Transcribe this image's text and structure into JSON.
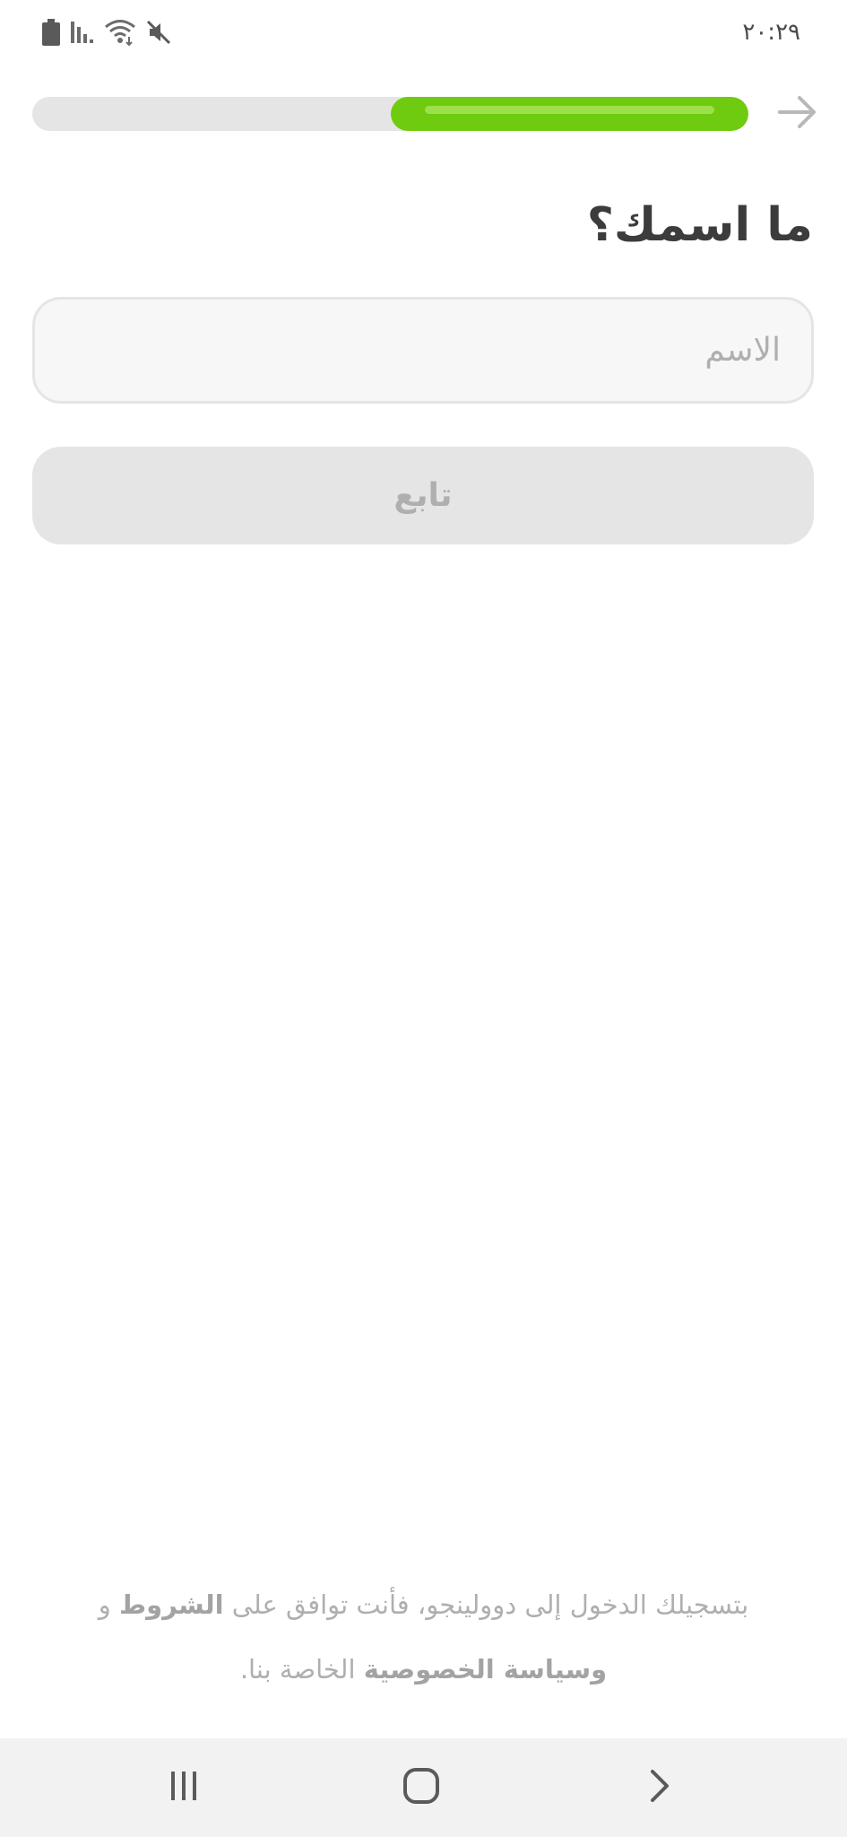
{
  "status_bar": {
    "time": "٢٠:٢٩",
    "icons": [
      "battery-icon",
      "signal-icon",
      "wifi-icon",
      "mute-icon"
    ]
  },
  "header": {
    "progress": 0.5,
    "forward_icon": "arrow-right-icon"
  },
  "question": {
    "title": "ما اسمك؟"
  },
  "name_input": {
    "placeholder": "الاسم",
    "value": ""
  },
  "continue_button": {
    "label": "تابع",
    "enabled": false
  },
  "legal": {
    "text_1": "بتسجيلك الدخول إلى دوولينجو، فأنت توافق على ",
    "terms_link": "الشروط",
    "text_2": " و ",
    "privacy_link": "وسياسة الخصوصية",
    "text_3": " الخاصة بنا."
  },
  "nav_bar": {
    "icons": [
      "recent-apps-icon",
      "home-icon",
      "back-icon"
    ]
  },
  "colors": {
    "accent": "#6fcb0f",
    "track": "#e5e5e5",
    "disabled_text": "#afafaf",
    "title_text": "#3c3c3c"
  }
}
